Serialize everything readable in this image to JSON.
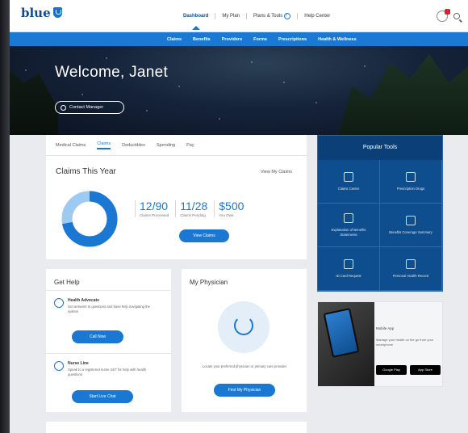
{
  "header": {
    "logo_text": "blue",
    "logo_sub": "",
    "nav": [
      {
        "label": "Dashboard",
        "active": true
      },
      {
        "label": "My Plan"
      },
      {
        "label": "Plans & Tools"
      },
      {
        "label": "Help Center"
      }
    ]
  },
  "subnav": [
    "Claims",
    "Benefits",
    "Providers",
    "Forms",
    "Prescriptions",
    "Health & Wellness"
  ],
  "hero": {
    "title": "Welcome, Janet",
    "subtitle": "",
    "button_label": "Contact Manager"
  },
  "claims": {
    "tabs": [
      "Medical Claims",
      "Claims",
      "Deductibles",
      "Spending",
      "Pay"
    ],
    "active_tab_index": 1,
    "title": "Claims This Year",
    "link": "View My Claims",
    "stats": [
      {
        "value": "12/90",
        "label": "Claims Processed"
      },
      {
        "value": "11/28",
        "label": "Claims Pending"
      },
      {
        "value": "$500",
        "label": "You Owe"
      }
    ],
    "donut_fraction": 0.72,
    "button_label": "View Claims",
    "colors": {
      "primary": "#1a78d2",
      "secondary": "#9ccaf1"
    }
  },
  "popular": {
    "title": "Popular Tools",
    "items": [
      {
        "label": "Claims Center"
      },
      {
        "label": "Prescription Drugs"
      },
      {
        "label": "Explanation of Benefits Statements"
      },
      {
        "label": "Benefits Coverage Summary"
      },
      {
        "label": "ID Card Request"
      },
      {
        "label": "Personal Health Record"
      }
    ]
  },
  "gethelp": {
    "title": "Get Help",
    "items": [
      {
        "head": "Health Advocate",
        "desc": "Get answers to questions and have help navigating the system",
        "button": "Call Now"
      },
      {
        "head": "Nurse Line",
        "desc": "Speak to a registered nurse 24/7 for help with health questions",
        "button": "Start Live Chat"
      }
    ]
  },
  "physician": {
    "title": "My Physician",
    "desc": "Locate your preferred physician or primary care provider",
    "button": "Find My Physician"
  },
  "promo": {
    "title": "Mobile App",
    "desc": "Manage your health on the go from your smartphone",
    "store1": "Google Play",
    "store2": "App Store"
  }
}
